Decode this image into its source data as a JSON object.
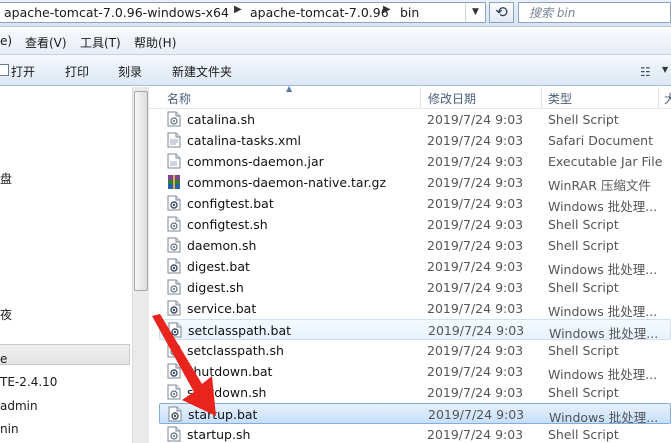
{
  "address_bar": {
    "crumbs": [
      "apache-tomcat-7.0.96-windows-x64",
      "apache-tomcat-7.0.96",
      "bin"
    ],
    "separator": "▶",
    "refresh_icon": "refresh-icon",
    "search_placeholder": "搜索 bin"
  },
  "menu": [
    "e)",
    "查看(V)",
    "工具(T)",
    "帮助(H)"
  ],
  "toolbar": {
    "open": "打开",
    "print": "打印",
    "burn": "刻录",
    "new_folder": "新建文件夹",
    "view_icon": "view-options-icon"
  },
  "nav": {
    "items": [
      "盘",
      "夜",
      "e",
      "TE-2.4.10",
      "admin",
      "nin"
    ]
  },
  "columns": {
    "name": "名称",
    "date": "修改日期",
    "type": "类型",
    "size": "大"
  },
  "files": [
    {
      "name": "catalina.sh",
      "date": "2019/7/24 9:03",
      "type": "Shell Script",
      "icon": "script-file-icon"
    },
    {
      "name": "catalina-tasks.xml",
      "date": "2019/7/24 9:03",
      "type": "Safari Document",
      "icon": "document-file-icon"
    },
    {
      "name": "commons-daemon.jar",
      "date": "2019/7/24 9:03",
      "type": "Executable Jar File",
      "icon": "jar-file-icon"
    },
    {
      "name": "commons-daemon-native.tar.gz",
      "date": "2019/7/24 9:03",
      "type": "WinRAR 压缩文件",
      "icon": "winrar-archive-icon"
    },
    {
      "name": "configtest.bat",
      "date": "2019/7/24 9:03",
      "type": "Windows 批处理...",
      "icon": "batch-file-icon"
    },
    {
      "name": "configtest.sh",
      "date": "2019/7/24 9:03",
      "type": "Shell Script",
      "icon": "script-file-icon"
    },
    {
      "name": "daemon.sh",
      "date": "2019/7/24 9:03",
      "type": "Shell Script",
      "icon": "script-file-icon"
    },
    {
      "name": "digest.bat",
      "date": "2019/7/24 9:03",
      "type": "Windows 批处理...",
      "icon": "batch-file-icon"
    },
    {
      "name": "digest.sh",
      "date": "2019/7/24 9:03",
      "type": "Shell Script",
      "icon": "script-file-icon"
    },
    {
      "name": "service.bat",
      "date": "2019/7/24 9:03",
      "type": "Windows 批处理...",
      "icon": "batch-file-icon"
    },
    {
      "name": "setclasspath.bat",
      "date": "2019/7/24 9:03",
      "type": "Windows 批处理...",
      "icon": "batch-file-icon",
      "state": "hover"
    },
    {
      "name": "setclasspath.sh",
      "date": "2019/7/24 9:03",
      "type": "Shell Script",
      "icon": "script-file-icon"
    },
    {
      "name": "shutdown.bat",
      "date": "2019/7/24 9:03",
      "type": "Windows 批处理...",
      "icon": "batch-file-icon"
    },
    {
      "name": "shutdown.sh",
      "date": "2019/7/24 9:03",
      "type": "Shell Script",
      "icon": "script-file-icon"
    },
    {
      "name": "startup.bat",
      "date": "2019/7/24 9:03",
      "type": "Windows 批处理...",
      "icon": "batch-file-icon",
      "state": "selected"
    },
    {
      "name": "startup.sh",
      "date": "2019/7/24 9:03",
      "type": "Shell Script",
      "icon": "script-file-icon"
    }
  ],
  "annotation": {
    "color": "#e8241c",
    "icon": "red-arrow-icon"
  }
}
